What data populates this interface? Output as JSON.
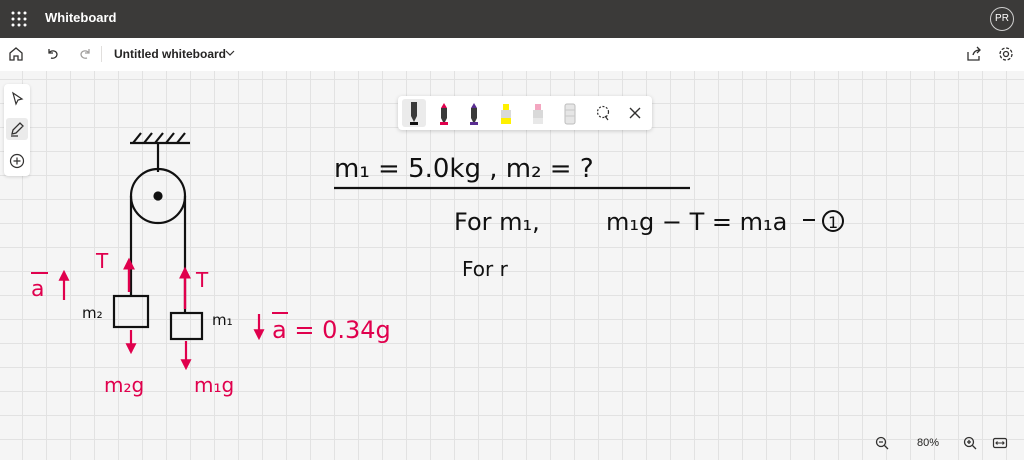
{
  "app": {
    "title": "Whiteboard",
    "avatar_initials": "PR"
  },
  "toolbar": {
    "doc_title": "Untitled whiteboard"
  },
  "zoom": {
    "level": "80%"
  },
  "colors": {
    "titlebar": "#3b3a39",
    "ink_black": "#111111",
    "ink_red": "#e0004d"
  },
  "pens": [
    {
      "name": "black-pen",
      "color": "#111111"
    },
    {
      "name": "red-pen",
      "color": "#e0004d"
    },
    {
      "name": "purple-pen",
      "color": "#5a2d91"
    },
    {
      "name": "yellow-highlighter",
      "color": "#fff100"
    },
    {
      "name": "pink-highlighter",
      "color": "#f3a6c0"
    },
    {
      "name": "eraser",
      "color": "#cccccc"
    }
  ],
  "ink": {
    "given": "m₁ = 5.0kg ,  m₂ = ?",
    "eq1_prefix": "For m₁,",
    "eq1": "m₁g − T = m₁a",
    "eq1_num": "1",
    "for_partial": "For r",
    "tension": "T",
    "accel_left": "a",
    "accel_right": "a = 0.34g",
    "m2_label": "m₂",
    "m1_label": "m₁",
    "weight_m2": "m₂g",
    "weight_m1": "m₁g"
  }
}
